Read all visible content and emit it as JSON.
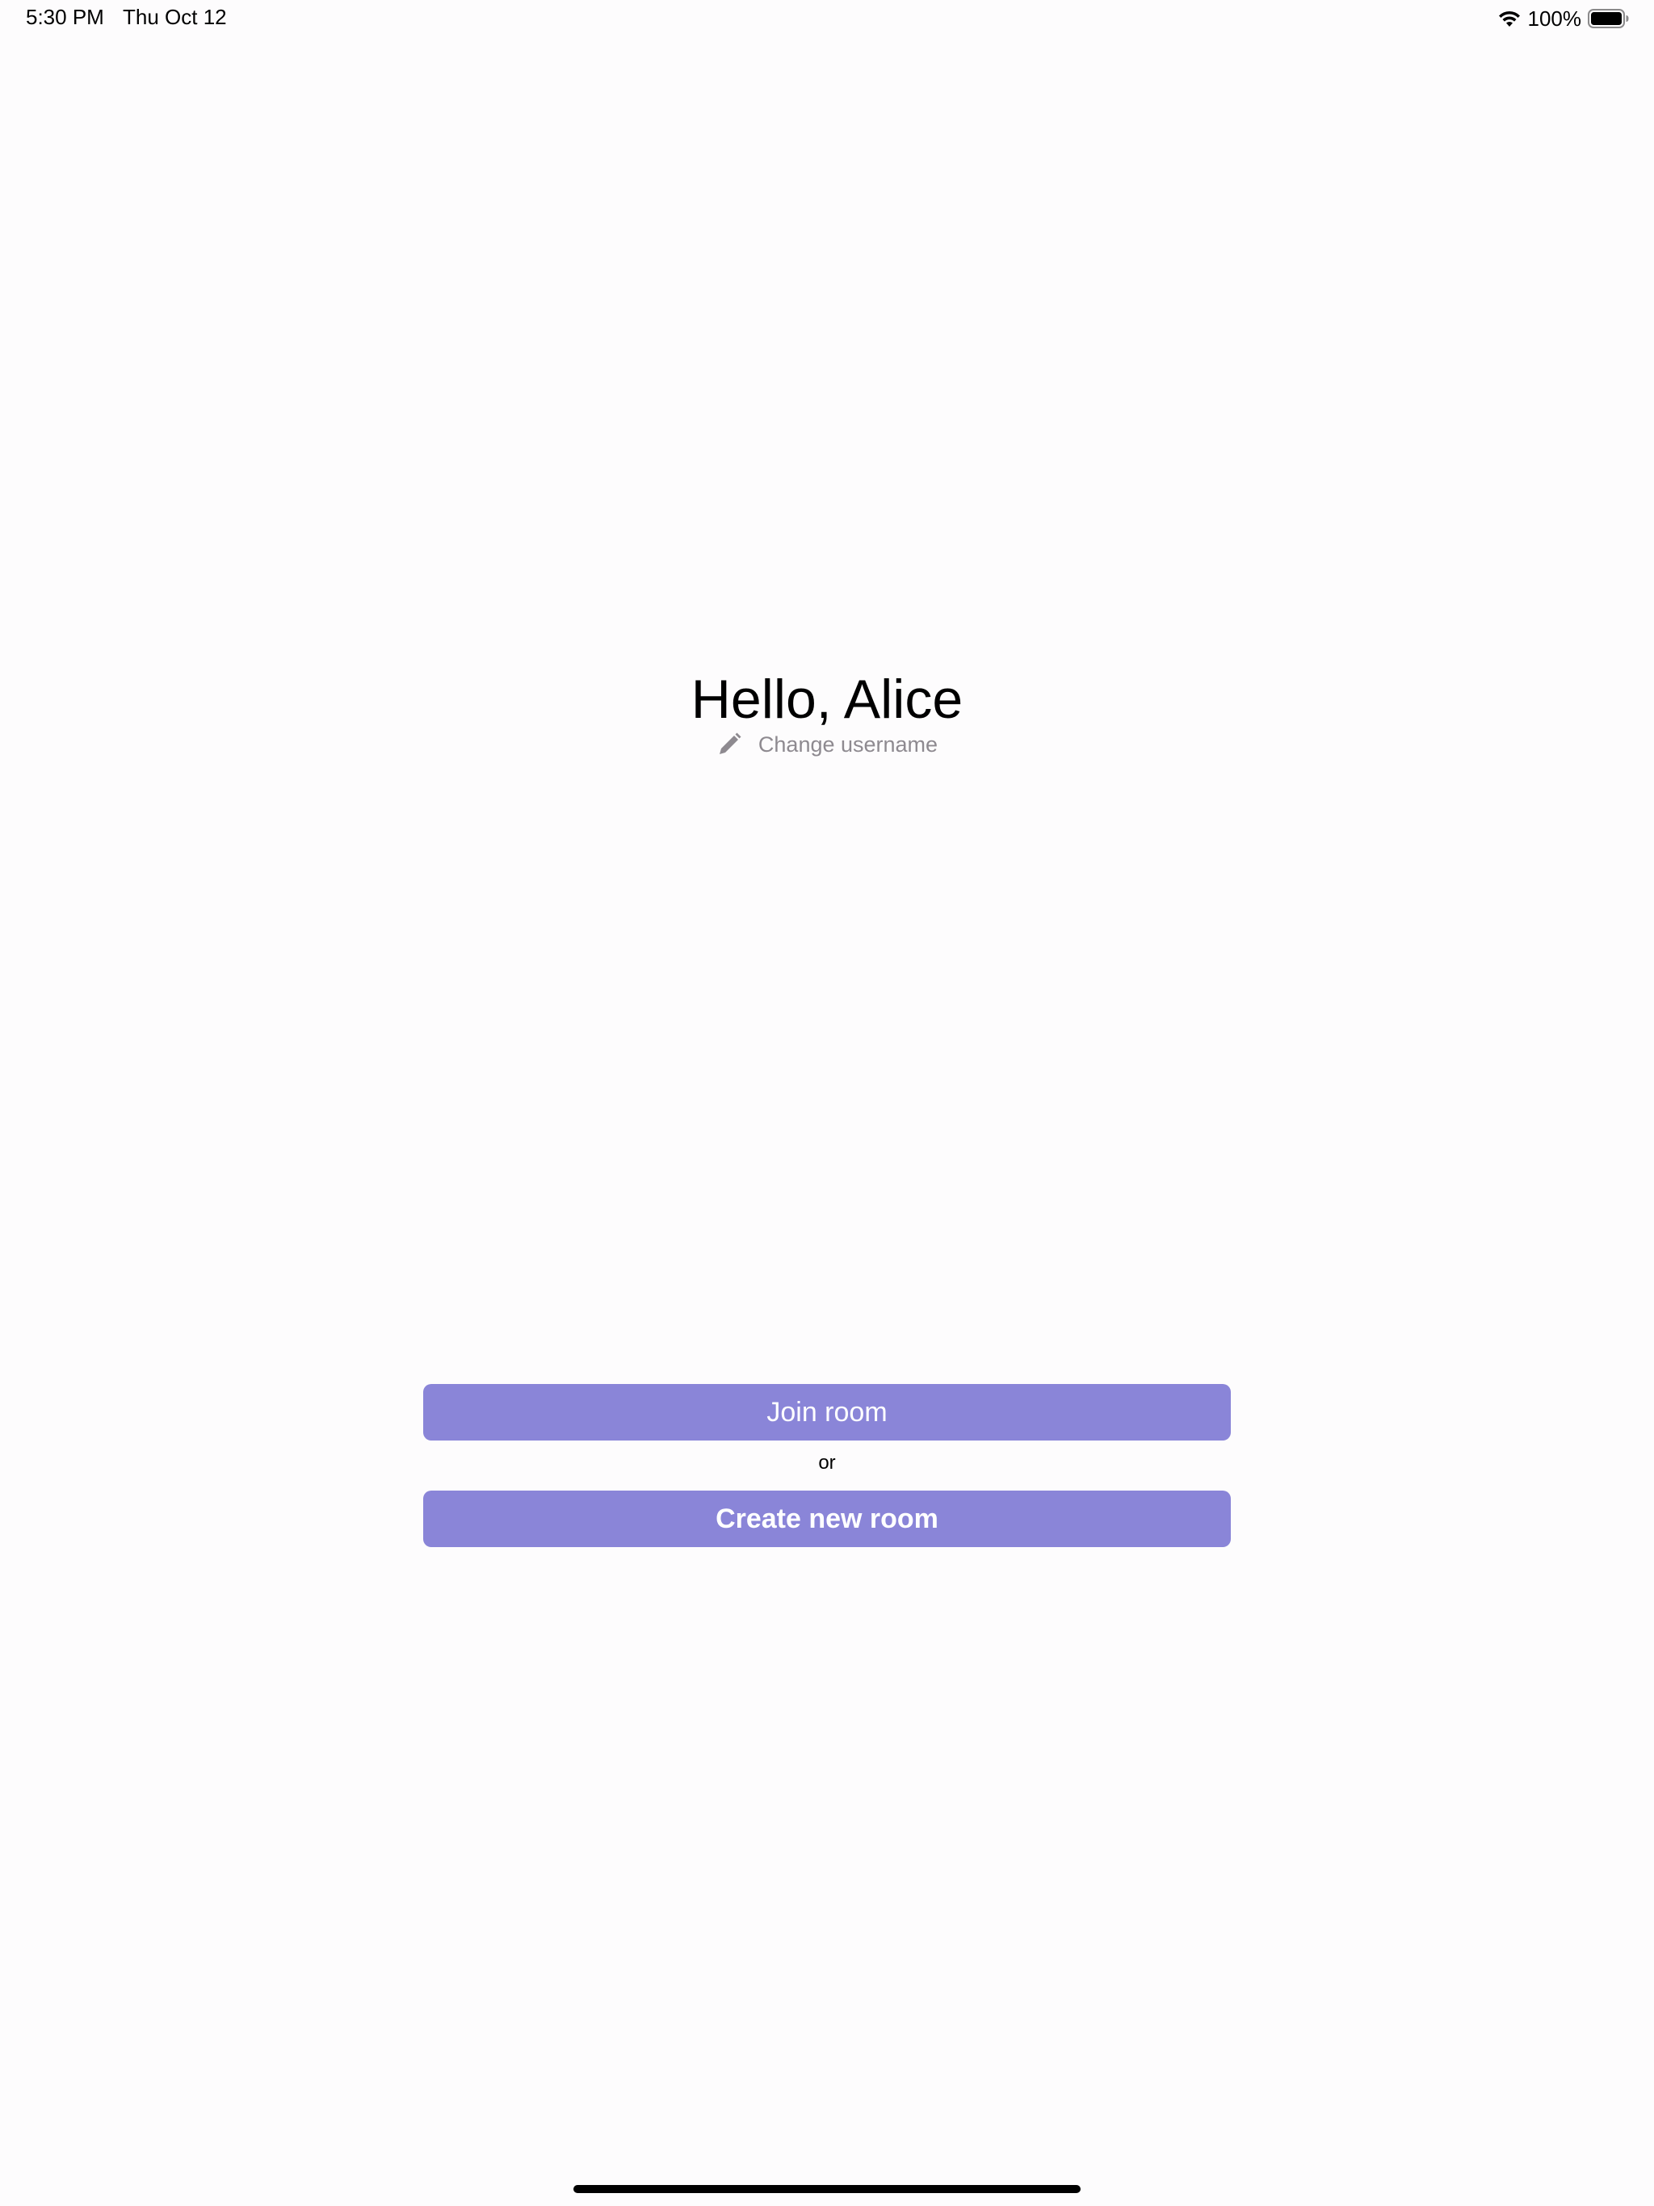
{
  "status_bar": {
    "time": "5:30 PM",
    "date": "Thu Oct 12",
    "battery_percent": "100%",
    "battery_level": 1.0,
    "icons": [
      "wifi-icon",
      "battery-icon"
    ]
  },
  "main": {
    "greeting": "Hello, Alice",
    "change_username_label": "Change username",
    "change_username_icon": "pencil-icon",
    "join_button_label": "Join room",
    "or_label": "or",
    "create_button_label": "Create new room"
  },
  "colors": {
    "accent": "#8a85d8",
    "secondary_text": "#8e8a90",
    "background": "#fdfcfd"
  }
}
